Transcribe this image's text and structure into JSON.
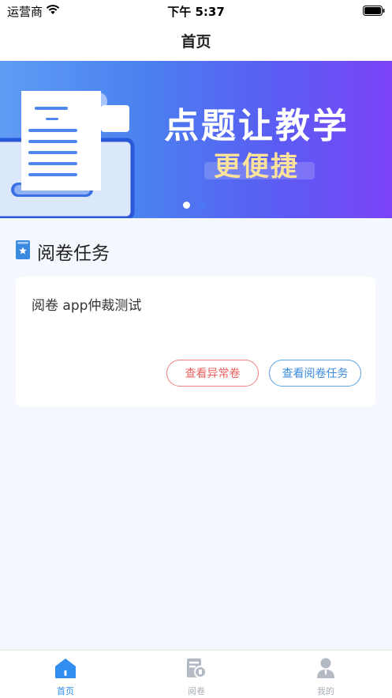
{
  "status_bar": {
    "carrier": "运营商",
    "time": "下午 5:37"
  },
  "nav": {
    "title": "首页"
  },
  "banner": {
    "headline": "点题让教学",
    "subline": "更便捷",
    "active_slide": 1,
    "slide_count": 2
  },
  "section": {
    "title": "阅卷任务"
  },
  "task": {
    "name": "阅卷 app仲裁测试",
    "abnormal_button": "查看异常卷",
    "review_button": "查看阅卷任务"
  },
  "tabs": [
    {
      "label": "首页",
      "icon": "home-icon",
      "active": true
    },
    {
      "label": "阅卷",
      "icon": "grading-icon",
      "active": false
    },
    {
      "label": "我的",
      "icon": "profile-icon",
      "active": false
    }
  ],
  "colors": {
    "accent": "#2f8ef0",
    "danger": "#ec5f5f",
    "banner_start": "#5f9cf5",
    "banner_end": "#7b43f6",
    "highlight_text": "#fde39a"
  }
}
